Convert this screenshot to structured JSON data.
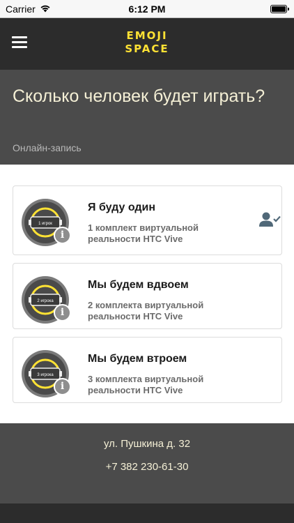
{
  "status_bar": {
    "carrier": "Carrier",
    "time": "6:12 PM",
    "icons": [
      "wifi-icon",
      "battery-icon"
    ]
  },
  "nav": {
    "logo_line1": "EMOJI",
    "logo_line2": "SPACE",
    "menu_icon": "hamburger-menu-icon"
  },
  "header": {
    "title": "Сколько человек будет играть?",
    "subtitle": "Онлайн-запись"
  },
  "options": [
    {
      "title": "Я буду один",
      "description": "1 комплект виртуальной реальности HTC Vive",
      "badge": "1 игрок",
      "selected": true
    },
    {
      "title": "Мы будем вдвоем",
      "description": "2 комплекта виртуальной реальности HTC Vive",
      "badge": "2 игрока",
      "selected": false
    },
    {
      "title": "Мы будем втроем",
      "description": "3 комплекта виртуальной реальности HTC Vive",
      "badge": "3 игрока",
      "selected": false
    }
  ],
  "footer": {
    "address": "ул. Пушкина д. 32",
    "phone": "+7 382 230-61-30"
  },
  "colors": {
    "accent": "#ffe234",
    "dark": "#2c2c2c",
    "header_bg": "#4b4b4b",
    "selected_icon": "#506878"
  }
}
